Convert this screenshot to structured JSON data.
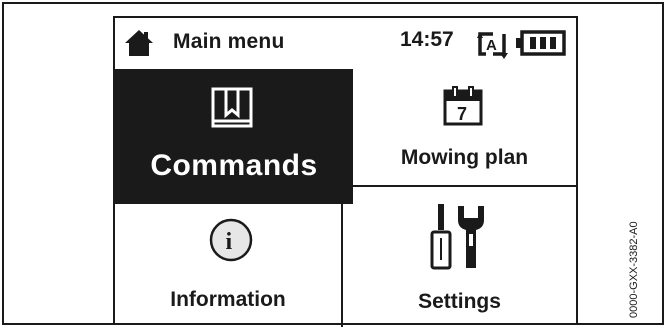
{
  "header": {
    "title": "Main menu",
    "time": "14:57",
    "home_icon": "home-icon",
    "mode_icon": "auto-mode-icon",
    "battery_icon": "battery-full-icon"
  },
  "tiles": [
    {
      "label": "Commands",
      "icon": "book-bookmark-icon",
      "selected": true
    },
    {
      "label": "Mowing plan",
      "icon": "calendar-icon",
      "calendar_number": "7"
    },
    {
      "label": "Information",
      "icon": "info-icon",
      "icon_letter": "i"
    },
    {
      "label": "Settings",
      "icon": "tools-icon"
    }
  ],
  "auto_icon_letter": "A",
  "figure_code": "0000-GXX-3382-A0",
  "colors": {
    "selected_bg": "#1a1a1a",
    "selected_fg": "#ffffff",
    "info_circle": "#e6e6e6"
  }
}
